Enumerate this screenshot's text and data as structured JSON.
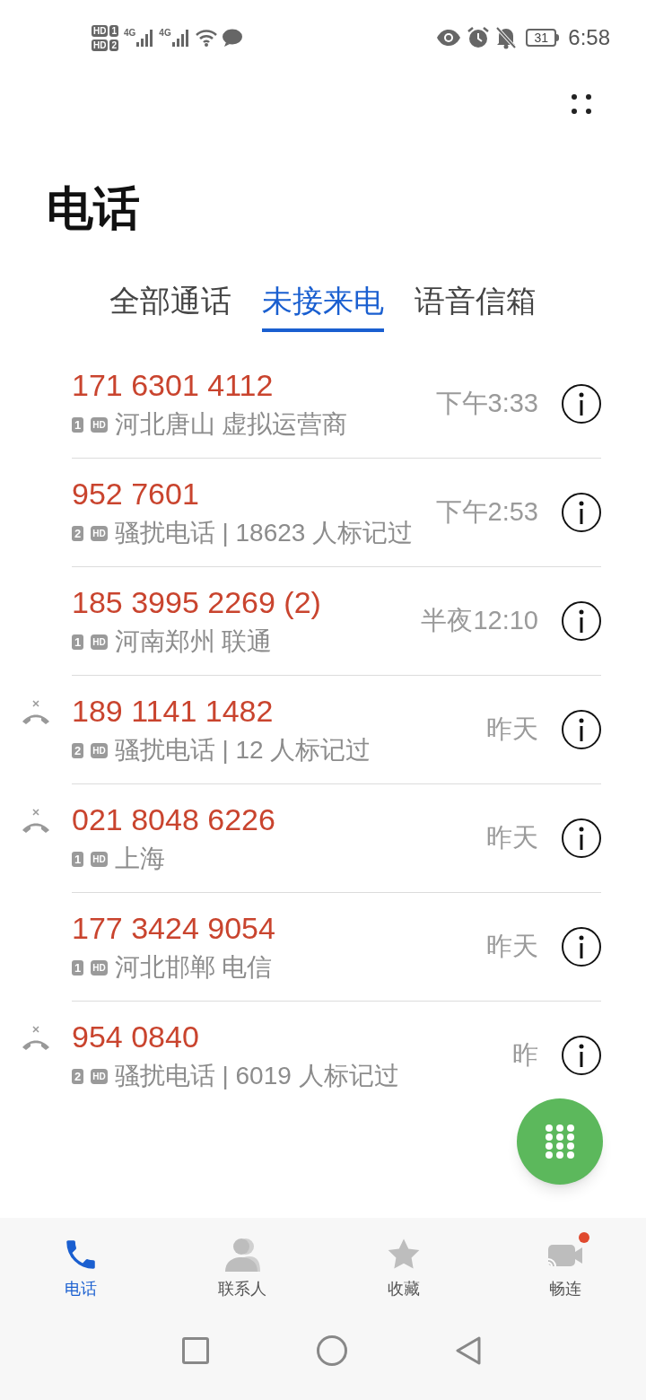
{
  "status_bar": {
    "sim_badges": [
      {
        "label": "HD",
        "sim": "1"
      },
      {
        "label": "HD",
        "sim": "2"
      }
    ],
    "networks": [
      "4G",
      "4G"
    ],
    "battery": "31",
    "time": "6:58"
  },
  "title": "电话",
  "tabs": [
    {
      "label": "全部通话",
      "selected": false
    },
    {
      "label": "未接来电",
      "selected": true
    },
    {
      "label": "语音信箱",
      "selected": false
    }
  ],
  "calls": [
    {
      "number": "171 6301 4112",
      "rejected": false,
      "sim": "1",
      "hd": "HD",
      "location": "河北唐山 虚拟运营商",
      "time": "下午3:33"
    },
    {
      "number": "952 7601",
      "rejected": false,
      "sim": "2",
      "hd": "HD",
      "location": "骚扰电话 | 18623 人标记过",
      "time": "下午2:53"
    },
    {
      "number": "185 3995 2269 (2)",
      "rejected": false,
      "sim": "1",
      "hd": "HD",
      "location": "河南郑州 联通",
      "time": "半夜12:10"
    },
    {
      "number": "189 1141 1482",
      "rejected": true,
      "sim": "2",
      "hd": "HD",
      "location": "骚扰电话 | 12 人标记过",
      "time": "昨天"
    },
    {
      "number": "021 8048 6226",
      "rejected": true,
      "sim": "1",
      "hd": "HD",
      "location": "上海",
      "time": "昨天"
    },
    {
      "number": "177 3424 9054",
      "rejected": false,
      "sim": "1",
      "hd": "HD",
      "location": "河北邯郸 电信",
      "time": "昨天"
    },
    {
      "number": "954 0840",
      "rejected": true,
      "sim": "2",
      "hd": "HD",
      "location": "骚扰电话 | 6019 人标记过",
      "time": "昨"
    }
  ],
  "bottom_nav": [
    {
      "kind": "phone",
      "label": "电话",
      "selected": true,
      "notification": false
    },
    {
      "kind": "contacts",
      "label": "联系人",
      "selected": false,
      "notification": false
    },
    {
      "kind": "favorites",
      "label": "收藏",
      "selected": false,
      "notification": false
    },
    {
      "kind": "meetime",
      "label": "畅连",
      "selected": false,
      "notification": true
    }
  ]
}
